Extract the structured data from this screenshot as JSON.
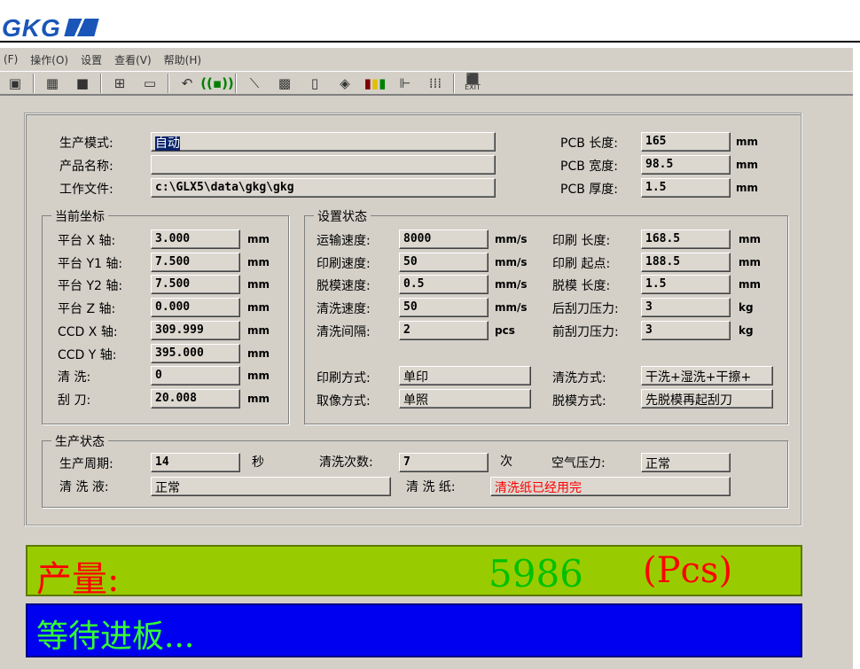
{
  "logo": "GKG",
  "menu": [
    "(F)",
    "操作(O)",
    "设置",
    "查看(V)",
    "帮助(H)"
  ],
  "toolbar": {
    "exit_label": "EXIT"
  },
  "top": {
    "mode_label": "生产模式:",
    "mode": "自动",
    "name_label": "产品名称:",
    "name": "",
    "file_label": "工作文件:",
    "file": "c:\\GLX5\\data\\gkg\\gkg",
    "pcb_len_label": "PCB 长度:",
    "pcb_len": "165",
    "pcb_wid_label": "PCB 宽度:",
    "pcb_wid": "98.5",
    "pcb_thk_label": "PCB 厚度:",
    "pcb_thk": "1.5",
    "unit": "mm"
  },
  "coords": {
    "title": "当前坐标",
    "rows": [
      {
        "label": "平台 X 轴:",
        "value": "3.000",
        "unit": "mm"
      },
      {
        "label": "平台 Y1 轴:",
        "value": "7.500",
        "unit": "mm"
      },
      {
        "label": "平台 Y2 轴:",
        "value": "7.500",
        "unit": "mm"
      },
      {
        "label": "平台 Z 轴:",
        "value": "0.000",
        "unit": "mm"
      },
      {
        "label": "CCD X 轴:",
        "value": "309.999",
        "unit": "mm"
      },
      {
        "label": "CCD Y 轴:",
        "value": "395.000",
        "unit": "mm"
      },
      {
        "label": "清    洗:",
        "value": "0",
        "unit": "mm"
      },
      {
        "label": "刮    刀:",
        "value": "20.008",
        "unit": "mm"
      }
    ]
  },
  "settings": {
    "title": "设置状态",
    "left": [
      {
        "label": "运输速度:",
        "value": "8000",
        "unit": "mm/s"
      },
      {
        "label": "印刷速度:",
        "value": "50",
        "unit": "mm/s"
      },
      {
        "label": "脱模速度:",
        "value": "0.5",
        "unit": "mm/s"
      },
      {
        "label": "清洗速度:",
        "value": "50",
        "unit": "mm/s"
      },
      {
        "label": "清洗间隔:",
        "value": "2",
        "unit": "pcs"
      }
    ],
    "right": [
      {
        "label": "印刷 长度:",
        "value": "168.5",
        "unit": "mm"
      },
      {
        "label": "印刷 起点:",
        "value": "188.5",
        "unit": "mm"
      },
      {
        "label": "脱模 长度:",
        "value": "1.5",
        "unit": "mm"
      },
      {
        "label": "后刮刀压力:",
        "value": "3",
        "unit": "kg"
      },
      {
        "label": "前刮刀压力:",
        "value": "3",
        "unit": "kg"
      }
    ],
    "print_mode_label": "印刷方式:",
    "print_mode": "单印",
    "camera_mode_label": "取像方式:",
    "camera_mode": "单照",
    "clean_mode_label": "清洗方式:",
    "clean_mode": "干洗+湿洗+干擦+",
    "demold_mode_label": "脱模方式:",
    "demold_mode": "先脱模再起刮刀"
  },
  "status": {
    "title": "生产状态",
    "cycle_label": "生产周期:",
    "cycle": "14",
    "cycle_unit": "秒",
    "clean_count_label": "清洗次数:",
    "clean_count": "7",
    "clean_count_unit": "次",
    "air_label": "空气压力:",
    "air": "正常",
    "liquid_label": "清 洗 液:",
    "liquid": "正常",
    "paper_label": "清 洗 纸:",
    "paper": "清洗纸已经用完",
    "paper_color": "#ff0000"
  },
  "output": {
    "label": "产量:",
    "count": "5986",
    "unit": "(Pcs)"
  },
  "message": "等待进板..."
}
